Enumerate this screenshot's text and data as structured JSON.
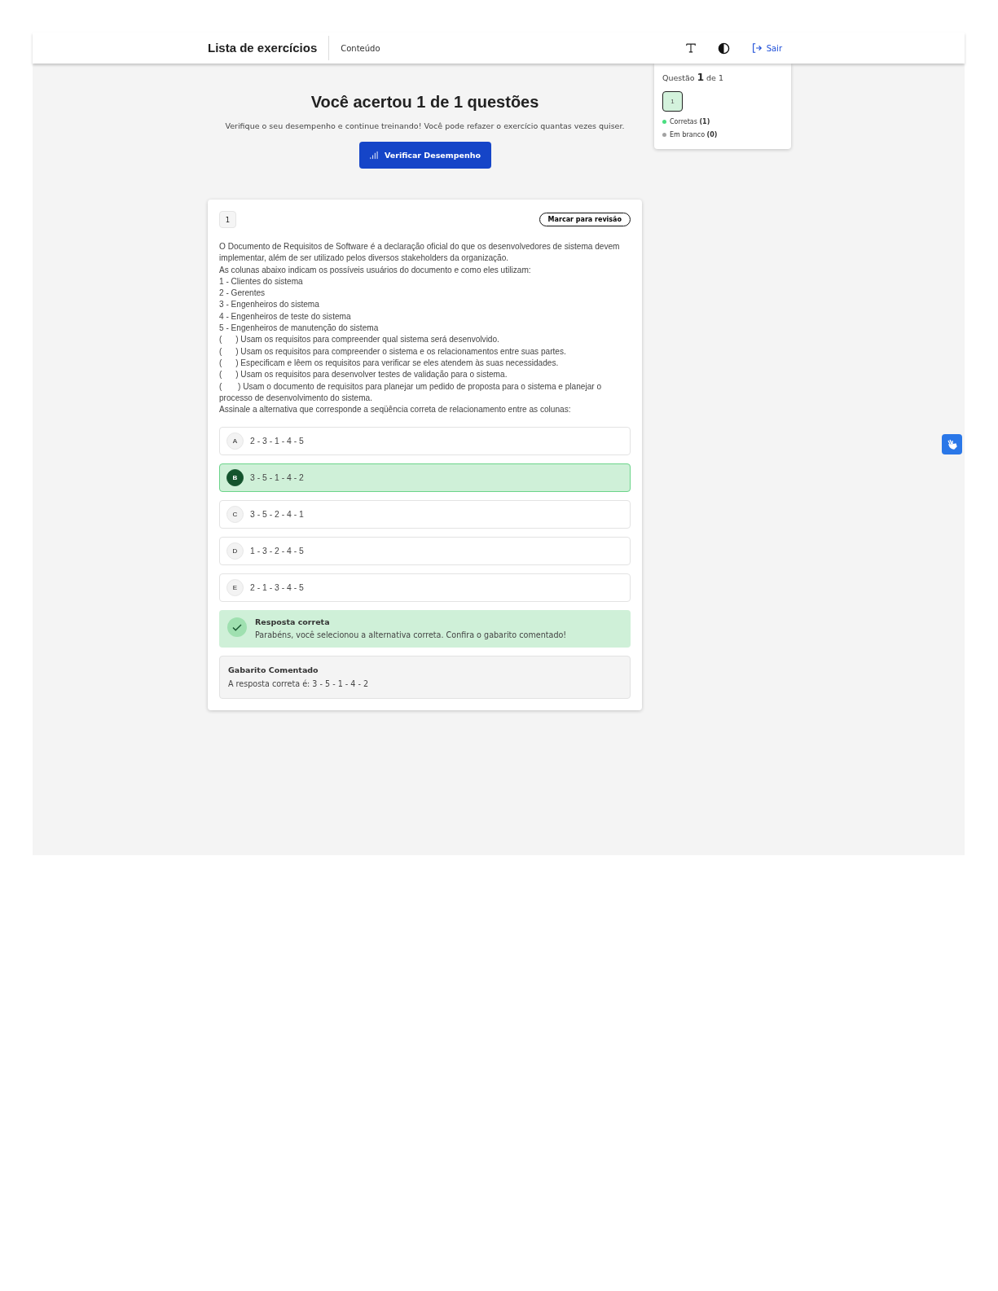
{
  "header": {
    "title": "Lista de exercícios",
    "nav_link": "Conteúdo",
    "exit_label": "Sair"
  },
  "summary": {
    "title": "Você acertou 1 de 1 questões",
    "subtitle": "Verifique o seu desempenho e continue treinando! Você pode refazer o exercício quantas vezes quiser.",
    "button": "Verificar Desempenho"
  },
  "panel": {
    "question_label": "Questão **1** de 1",
    "questions": [
      {
        "label": "1",
        "selected": true
      }
    ],
    "legend": [
      {
        "label": "Corretas **(1)**",
        "color": "#4ade80"
      },
      {
        "label": "Em branco **(0)**",
        "color": "#a3a3a3"
      }
    ]
  },
  "question": {
    "number": "1",
    "review_button": "Marcar para revisão",
    "statement": [
      "O Documento de Requisitos de Software é a declaração oficial do que os desenvolvedores de sistema devem implementar, além de ser utilizado pelos diversos stakeholders da organização.",
      "As colunas abaixo indicam os possíveis usuários do documento e como eles utilizam:",
      "1 - Clientes do sistema",
      "2 - Gerentes",
      "3 - Engenheiros do sistema",
      "4 - Engenheiros de teste do sistema",
      "5 - Engenheiros de manutenção do sistema",
      "(      ) Usam os requisitos para compreender qual sistema será desenvolvido.",
      "(      ) Usam os requisitos para compreender o sistema e os relacionamentos entre suas partes.",
      "(      ) Especificam e lêem os requisitos para verificar se eles atendem às suas necessidades.",
      "(      ) Usam os requisitos para desenvolver testes de validação para o sistema.",
      "(       ) Usam o documento de requisitos para planejar um pedido de proposta para o sistema e planejar o processo de desenvolvimento do sistema.",
      "Assinale a alternativa que corresponde a seqüência correta de relacionamento entre as colunas:"
    ],
    "options": [
      {
        "letter": "A",
        "text": "2 - 3 - 1 - 4 - 5",
        "selected": false
      },
      {
        "letter": "B",
        "text": "3 - 5 - 1 - 4 - 2",
        "selected": true
      },
      {
        "letter": "C",
        "text": "3 - 5 - 2 - 4 - 1",
        "selected": false
      },
      {
        "letter": "D",
        "text": "1 - 3 - 2 - 4 - 5",
        "selected": false
      },
      {
        "letter": "E",
        "text": "2 - 1 - 3 - 4 - 5",
        "selected": false
      }
    ],
    "feedback": {
      "title": "Resposta correta",
      "message": "Parabéns, você selecionou a alternativa correta. Confira o gabarito comentado!"
    },
    "answer": {
      "title": "Gabarito Comentado",
      "text": "A resposta correta é: 3 - 5 - 1 - 4 - 2"
    }
  }
}
